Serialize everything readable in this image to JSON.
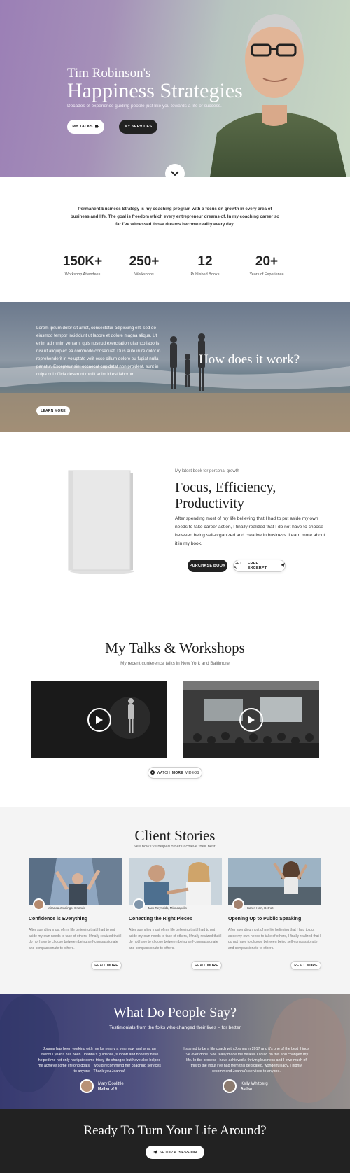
{
  "hero": {
    "kicker": "Tim Robinson's",
    "title": "Happiness Strategies",
    "subtitle": "Decades of experience guiding people just like you towards a life of success.",
    "btn_talks": "MY TALKS",
    "btn_services": "MY SERVICES"
  },
  "intro": {
    "text": "Permanent Business Strategy is my coaching program with a focus on growth in every area of business and life. The goal is freedom which every entrepreneur dreams of. In my coaching career so far I've witnessed those dreams become reality every day."
  },
  "stats": [
    {
      "value": "150K+",
      "label": "Workshop Attendees"
    },
    {
      "value": "250+",
      "label": "Workshops"
    },
    {
      "value": "12",
      "label": "Published Books"
    },
    {
      "value": "20+",
      "label": "Years of Experience"
    }
  ],
  "how": {
    "lorem": "Lorem ipsum dolor sit amet, consectetur adipiscing elit, sed do eiusmod tempor incididunt ut labore et dolore magna aliqua. Ut enim ad minim veniam, quis nostrud exercitation ullamco laboris nisi ut aliquip ex ea commodo consequat. Duis aute irure dolor in reprehenderit in voluptate velit esse cillum dolore eu fugiat nulla pariatur. Excepteur sint occaecat cupidatat non proident, sunt in culpa qui officia deserunt mollit anim id est laborum.",
    "title": "How does it work?",
    "learn": "LEARN MORE"
  },
  "book": {
    "kicker": "My latest book for personal growth",
    "title": "Focus, Efficiency, Productivity",
    "text": "After spending most of my life believing that I had to put aside my own needs to take career action, I finally realized that I do not have to choose between being self-organized and creative in business. Learn more about it in my book.",
    "btn_purchase": "PURCHASE BOOK",
    "btn_excerpt_pre": "GET A",
    "btn_excerpt_bold": "FREE EXCERPT"
  },
  "talks": {
    "title": "My Talks & Workshops",
    "subtitle": "My recent conference talks in New York and Baltimore",
    "watch_pre": "WATCH",
    "watch_bold": "MORE",
    "watch_post": "VIDEOS"
  },
  "stories": {
    "title": "Client Stories",
    "subtitle": "See how I've helped others achieve their best.",
    "read_pre": "READ",
    "read_bold": "MORE",
    "cards": [
      {
        "author": "Miranda Jennings, Orlando",
        "title": "Confidence is Everything",
        "text": "After spending most of my life believing that I had to put aside my own needs to take of others, I finally realized that I do not have to choose between being self-compassionate and compassionate to others."
      },
      {
        "author": "Jack Reynolds, Minneapolis",
        "title": "Conecting the Right Pieces",
        "text": "After spending most of my life believing that I had to put aside my own needs to take of others, I finally realized that I do not have to choose between being self-compassionate and compassionate to others."
      },
      {
        "author": "Karen Hart, Detroit",
        "title": "Opening Up to Public Speaking",
        "text": "After spending most of my life believing that I had to put aside my own needs to take of others, I finally realized that I do not have to choose between being self-compassionate and compassionate to others."
      }
    ]
  },
  "testimonials": {
    "title": "What Do People Say?",
    "subtitle": "Testimonials from the folks who changed their lives – for better",
    "items": [
      {
        "quote": "Joanna has been working with me for nearly a year now and what an eventful year it has been. Joanna's guidance, support and honesty have helped me not only navigate some tricky life changes but have also helped me achieve some lifelong goals. I would recommend her coaching services to anyone - Thank you Joanna!",
        "name": "Mary Doolittle",
        "role": "Mother of 4"
      },
      {
        "quote": "I started to be a life coach with Joanna in 2017 and it's one of the best things I've ever done. She really made me believe I could do this and changed my life. In the process I have achieved a thriving business and I owe much of this to the input I've had from this dedicated, wonderful lady. I highly recommend Joanna's services to anyone.",
        "name": "Kelly Whitberg",
        "role": "Author"
      }
    ]
  },
  "cta": {
    "title": "Ready To Turn Your Life Around?",
    "btn_pre": "SETUP A",
    "btn_bold": "SESSION"
  }
}
